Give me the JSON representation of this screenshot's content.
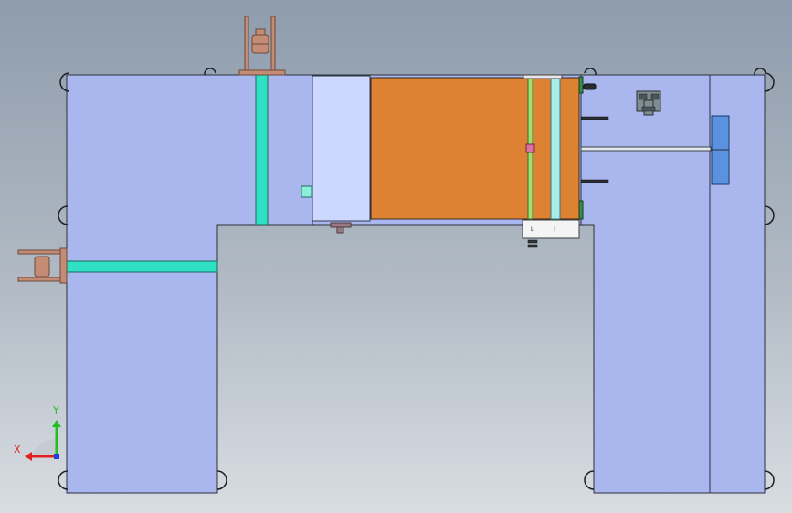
{
  "viewport": {
    "background_top": "#8e9cac",
    "background_bottom": "#d8dde2"
  },
  "colors": {
    "frame_fill": "#aab7ee",
    "frame_stroke": "#2a2f3a",
    "rail_teal": "#2fe0c4",
    "housing_light": "#ccd8ff",
    "panel_orange": "#dc8232",
    "spool_copper": "#c48c74",
    "roller_green": "#9fe070",
    "roller_cyan": "#a8ecec",
    "blue_plate": "#5a92e0",
    "motor_grey": "#7f8c90"
  },
  "triad": {
    "x_label": "X",
    "y_label": "Y",
    "x_color": "#e02020",
    "y_color": "#20c020",
    "z_color": "#2040e0"
  }
}
